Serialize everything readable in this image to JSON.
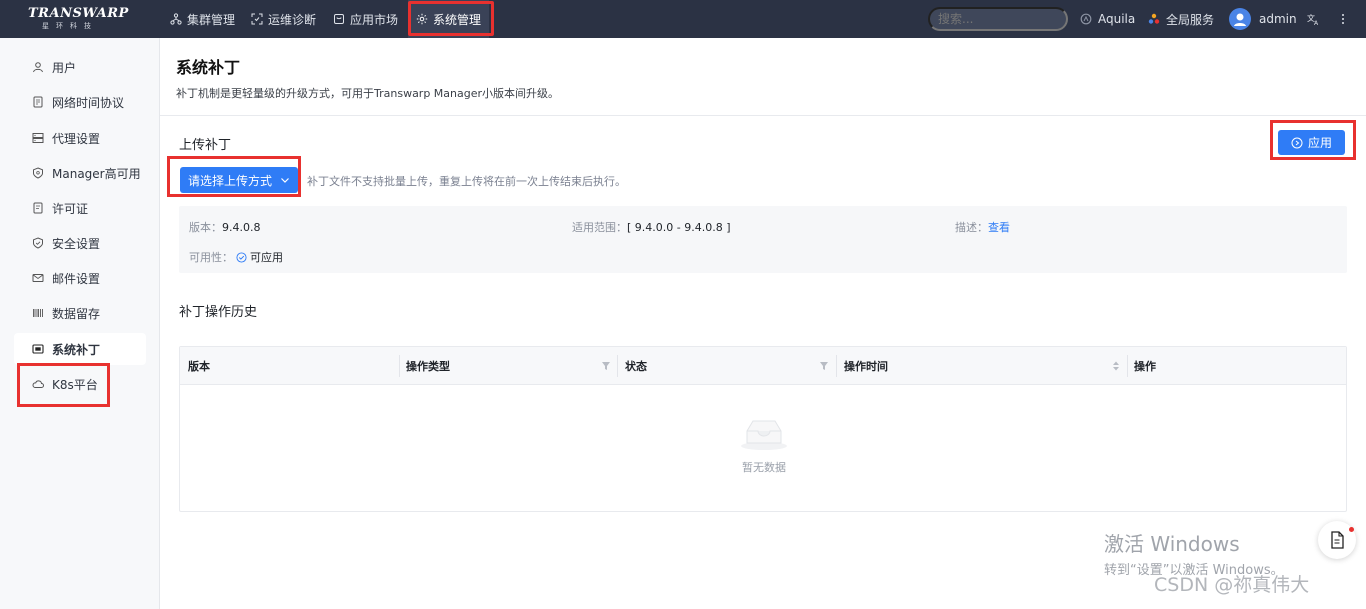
{
  "brand": {
    "logo_main": "TRANSWARP",
    "logo_sub": "星环科技"
  },
  "topnav": {
    "items": [
      {
        "label": "集群管理",
        "icon": "cluster-icon"
      },
      {
        "label": "运维诊断",
        "icon": "diagnosis-icon"
      },
      {
        "label": "应用市场",
        "icon": "market-icon"
      },
      {
        "label": "系统管理",
        "icon": "gear-icon",
        "active": true
      }
    ],
    "search_placeholder": "搜索...",
    "aquila": "Aquila",
    "global_service": "全局服务",
    "user": "admin"
  },
  "sidebar": {
    "items": [
      {
        "label": "用户",
        "icon": "user-icon"
      },
      {
        "label": "网络时间协议",
        "icon": "document-icon"
      },
      {
        "label": "代理设置",
        "icon": "proxy-icon"
      },
      {
        "label": "Manager高可用",
        "icon": "shield-icon"
      },
      {
        "label": "许可证",
        "icon": "license-icon"
      },
      {
        "label": "安全设置",
        "icon": "shield-icon"
      },
      {
        "label": "邮件设置",
        "icon": "mail-icon"
      },
      {
        "label": "数据留存",
        "icon": "barcode-icon"
      },
      {
        "label": "系统补丁",
        "icon": "patch-icon",
        "active": true
      },
      {
        "label": "K8s平台",
        "icon": "cloud-icon"
      }
    ]
  },
  "page": {
    "title": "系统补丁",
    "description": "补丁机制是更轻量级的升级方式，可用于Transwarp Manager小版本间升级。"
  },
  "upload": {
    "section_title": "上传补丁",
    "button_label": "请选择上传方式",
    "tip": "补丁文件不支持批量上传，重复上传将在前一次上传结束后执行。",
    "apply_label": "应用"
  },
  "patch_info": {
    "version_label": "版本：",
    "version_value": "9.4.0.8",
    "range_label": "适用范围：",
    "range_value": "[ 9.4.0.0 - 9.4.0.8 ]",
    "desc_label": "描述：",
    "desc_link": "查看",
    "availability_label": "可用性：",
    "availability_value": "可应用"
  },
  "history": {
    "section_title": "补丁操作历史",
    "columns": [
      "版本",
      "操作类型",
      "状态",
      "操作时间",
      "操作"
    ],
    "empty_text": "暂无数据"
  },
  "watermark": {
    "line1": "激活 Windows",
    "line2": "转到“设置”以激活 Windows。",
    "csdn": "CSDN @祢真伟大"
  }
}
